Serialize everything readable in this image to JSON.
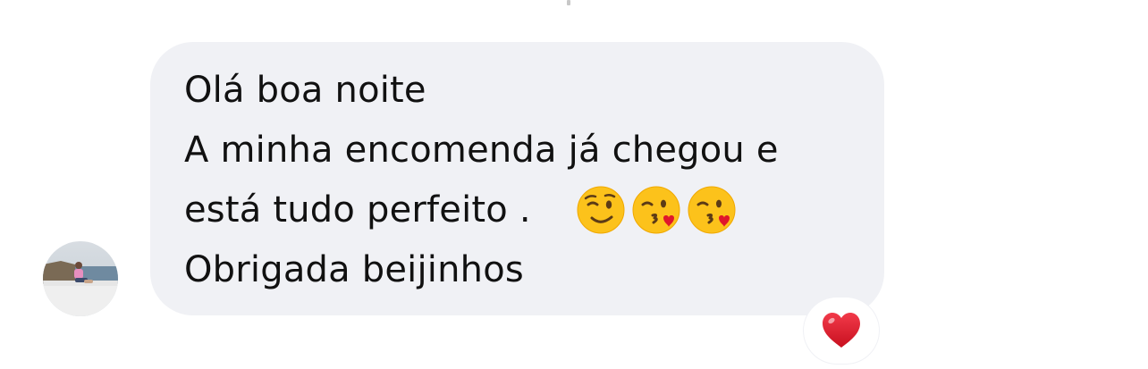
{
  "message": {
    "lines": [
      "Olá boa noite",
      "A minha encomenda já chegou e",
      "está tudo perfeito .",
      "Obrigada beijinhos"
    ],
    "emojis": [
      "winking-face-icon",
      "face-blowing-kiss-icon",
      "face-blowing-kiss-icon"
    ]
  },
  "reaction": {
    "icon": "red-heart-icon"
  },
  "colors": {
    "bubble": "#f0f1f5",
    "text": "#111111",
    "background": "#ffffff",
    "heart": "#e0162b"
  }
}
